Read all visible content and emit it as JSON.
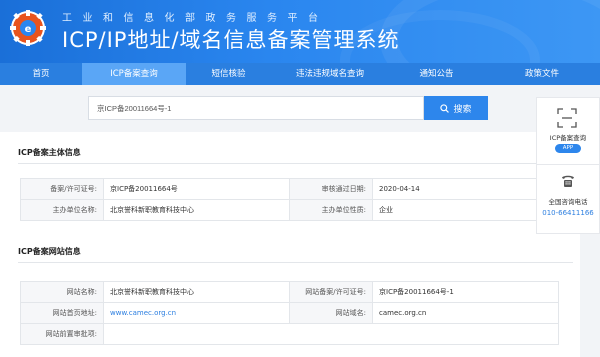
{
  "header": {
    "subtitle": "工业和信息化部政务服务平台",
    "title": "ICP/IP地址/域名信息备案管理系统"
  },
  "nav": {
    "items": [
      {
        "label": "首页"
      },
      {
        "label": "ICP备案查询"
      },
      {
        "label": "短信核验"
      },
      {
        "label": "违法违规域名查询"
      },
      {
        "label": "通知公告"
      },
      {
        "label": "政策文件"
      }
    ],
    "active_index": 1
  },
  "search": {
    "value": "京ICP备20011664号-1",
    "button_label": "搜索"
  },
  "subject_info": {
    "title": "ICP备案主体信息",
    "rows": [
      {
        "l1": "备案/许可证号:",
        "v1": "京ICP备20011664号",
        "l2": "审核通过日期:",
        "v2": "2020-04-14"
      },
      {
        "l1": "主办单位名称:",
        "v1": "北京誉科新职教育科技中心",
        "l2": "主办单位性质:",
        "v2": "企业"
      }
    ]
  },
  "website_info": {
    "title": "ICP备案网站信息",
    "rows": [
      {
        "l1": "网站名称:",
        "v1": "北京誉科新职教育科技中心",
        "l2": "网站备案/许可证号:",
        "v2": "京ICP备20011664号-1"
      },
      {
        "l1": "网站首页地址:",
        "v1": "www.camec.org.cn",
        "l2": "网站域名:",
        "v2": "camec.org.cn"
      },
      {
        "l1": "网站前置审批项:",
        "v1": "",
        "l2": "",
        "v2": ""
      }
    ]
  },
  "float_panel": {
    "query_label": "ICP备案查询",
    "app_badge": "APP",
    "hotline_label": "全国咨询电话",
    "hotline_number": "010-66411166"
  },
  "colors": {
    "header_blue": "#2a86ef",
    "nav_blue": "#2a7fe0",
    "nav_active": "#5aa6f6",
    "button_blue": "#2d86ec",
    "link_blue": "#2d7fe0"
  }
}
